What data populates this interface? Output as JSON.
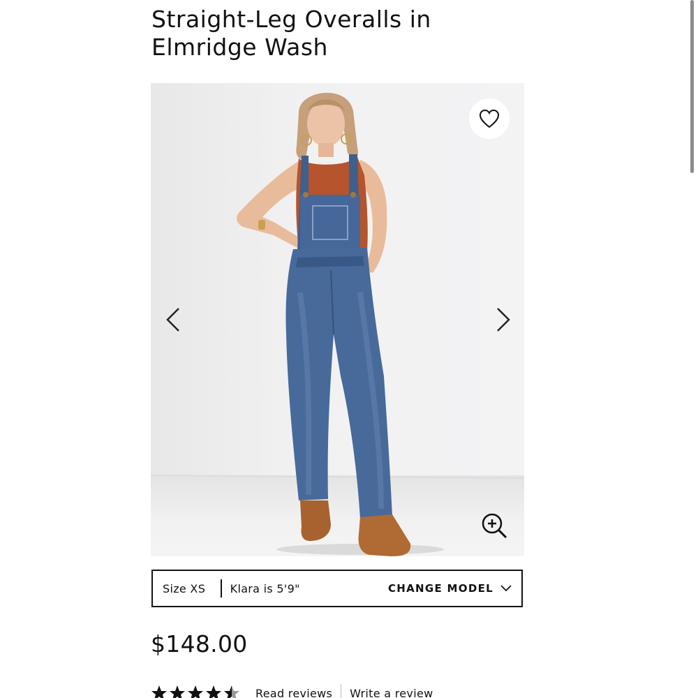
{
  "product": {
    "title": "Straight-Leg Overalls in Elmridge Wash",
    "price": "$148.00"
  },
  "gallery": {
    "image_subject": "model wearing denim overalls with rust tank top",
    "icons": {
      "favorite": "heart-icon",
      "previous": "chevron-left-icon",
      "next": "chevron-right-icon",
      "zoom": "zoom-in-icon"
    }
  },
  "model_info": {
    "size_label": "Size XS",
    "height_label": "Klara is 5'9\"",
    "change_model_label": "CHANGE MODEL",
    "change_icon": "chevron-down-icon"
  },
  "reviews": {
    "rating": 4.5,
    "rating_max": 5,
    "read_label": "Read reviews",
    "write_label": "Write a review"
  },
  "colors": {
    "text": "#111111",
    "denim": "#3f5f8c",
    "tank": "#b5542d",
    "background": "#ffffff"
  }
}
